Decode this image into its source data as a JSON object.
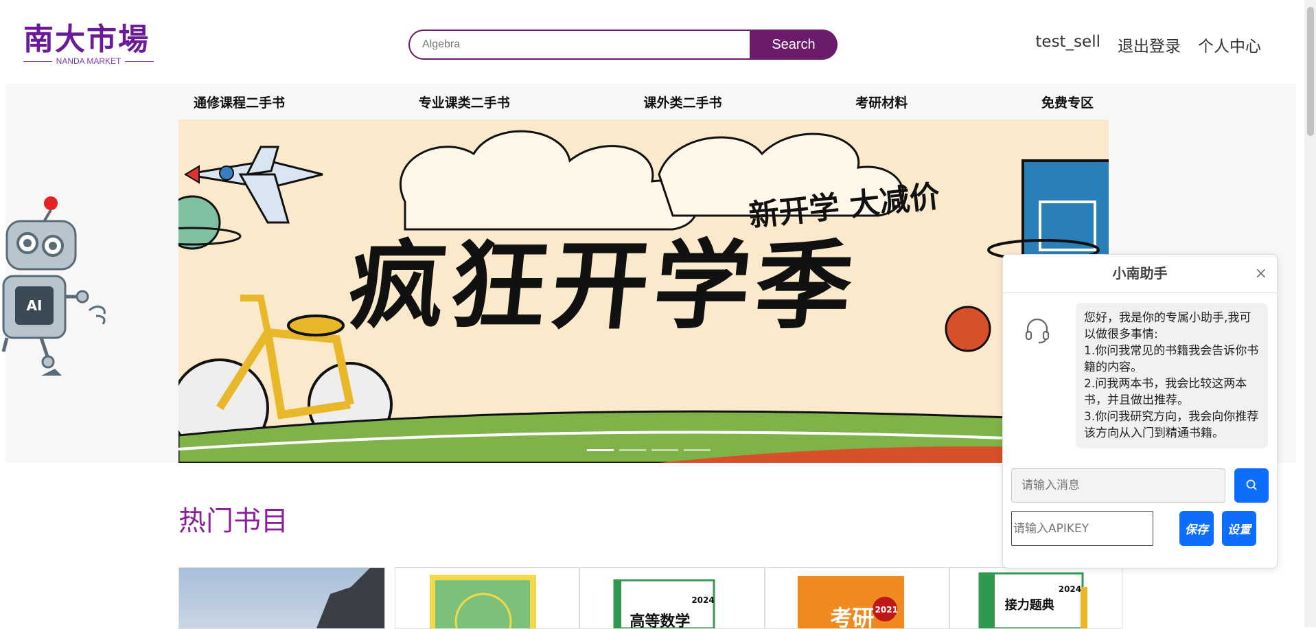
{
  "header": {
    "logo_cn": "南大市場",
    "logo_en": "NANDA MARKET",
    "search": {
      "value": "Algebra",
      "button": "Search"
    },
    "user": "test_sell",
    "logout": "退出登录",
    "profile": "个人中心"
  },
  "categories": [
    "通修课程二手书",
    "专业课类二手书",
    "课外类二手书",
    "考研材料",
    "免费专区"
  ],
  "banner": {
    "title": "疯狂开学季",
    "tag": "新开学 大减价",
    "slides": 4,
    "active_slide": 1
  },
  "robot_chip": "AI",
  "hot_books_title": "热门书目",
  "books": [
    {
      "label": ""
    },
    {
      "label": ""
    },
    {
      "label": "高等数学",
      "badge": "2024"
    },
    {
      "label": "考研",
      "badge": "2021"
    },
    {
      "label": "接力题典",
      "badge": "2024"
    }
  ],
  "chat": {
    "title": "小南助手",
    "close": "×",
    "message": "您好，我是你的专属小助手,我可以做很多事情:\n1.你问我常见的书籍我会告诉你书籍的内容。\n2.问我两本书，我会比较这两本书，并且做出推荐。\n3.你问我研究方向，我会向你推荐该方向从入门到精通书籍。",
    "input_placeholder": "请输入消息",
    "apikey_placeholder": "请输入APIKEY",
    "save": "保存",
    "settings": "设置"
  },
  "colors": {
    "brand": "#6a1b6a",
    "accent": "#8a1f9a",
    "primary": "#0d6efd"
  }
}
